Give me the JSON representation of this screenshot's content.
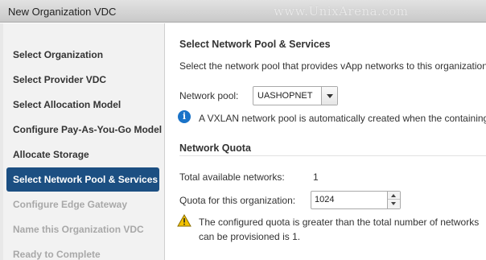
{
  "window": {
    "title": "New Organization VDC",
    "watermark": "www.UnixArena.com"
  },
  "sidebar": {
    "items": [
      {
        "label": "Select Organization",
        "state": "normal"
      },
      {
        "label": "Select Provider VDC",
        "state": "normal"
      },
      {
        "label": "Select Allocation Model",
        "state": "normal"
      },
      {
        "label": "Configure Pay-As-You-Go Model",
        "state": "normal"
      },
      {
        "label": "Allocate Storage",
        "state": "normal"
      },
      {
        "label": "Select Network Pool & Services",
        "state": "active"
      },
      {
        "label": "Configure Edge Gateway",
        "state": "disabled"
      },
      {
        "label": "Name this Organization VDC",
        "state": "disabled"
      },
      {
        "label": "Ready to Complete",
        "state": "disabled"
      }
    ]
  },
  "main": {
    "heading": "Select Network Pool & Services",
    "description": "Select the network pool that provides vApp networks to this organization",
    "network_pool": {
      "label": "Network pool:",
      "value": "UASHOPNET"
    },
    "info_text": "A VXLAN network pool is automatically created when the containing",
    "quota": {
      "heading": "Network Quota",
      "total_label": "Total available networks:",
      "total_value": "1",
      "quota_label": "Quota for this organization:",
      "quota_value": "1024",
      "warning_line1": "The configured quota is greater than the total number of networks",
      "warning_line2": "can be provisioned is 1."
    }
  },
  "icons": {
    "info": "info-icon",
    "warning": "warning-icon"
  },
  "colors": {
    "active_step_bg": "#1c4f82",
    "info_icon": "#1a73c8",
    "warning_icon": "#f2c200"
  }
}
